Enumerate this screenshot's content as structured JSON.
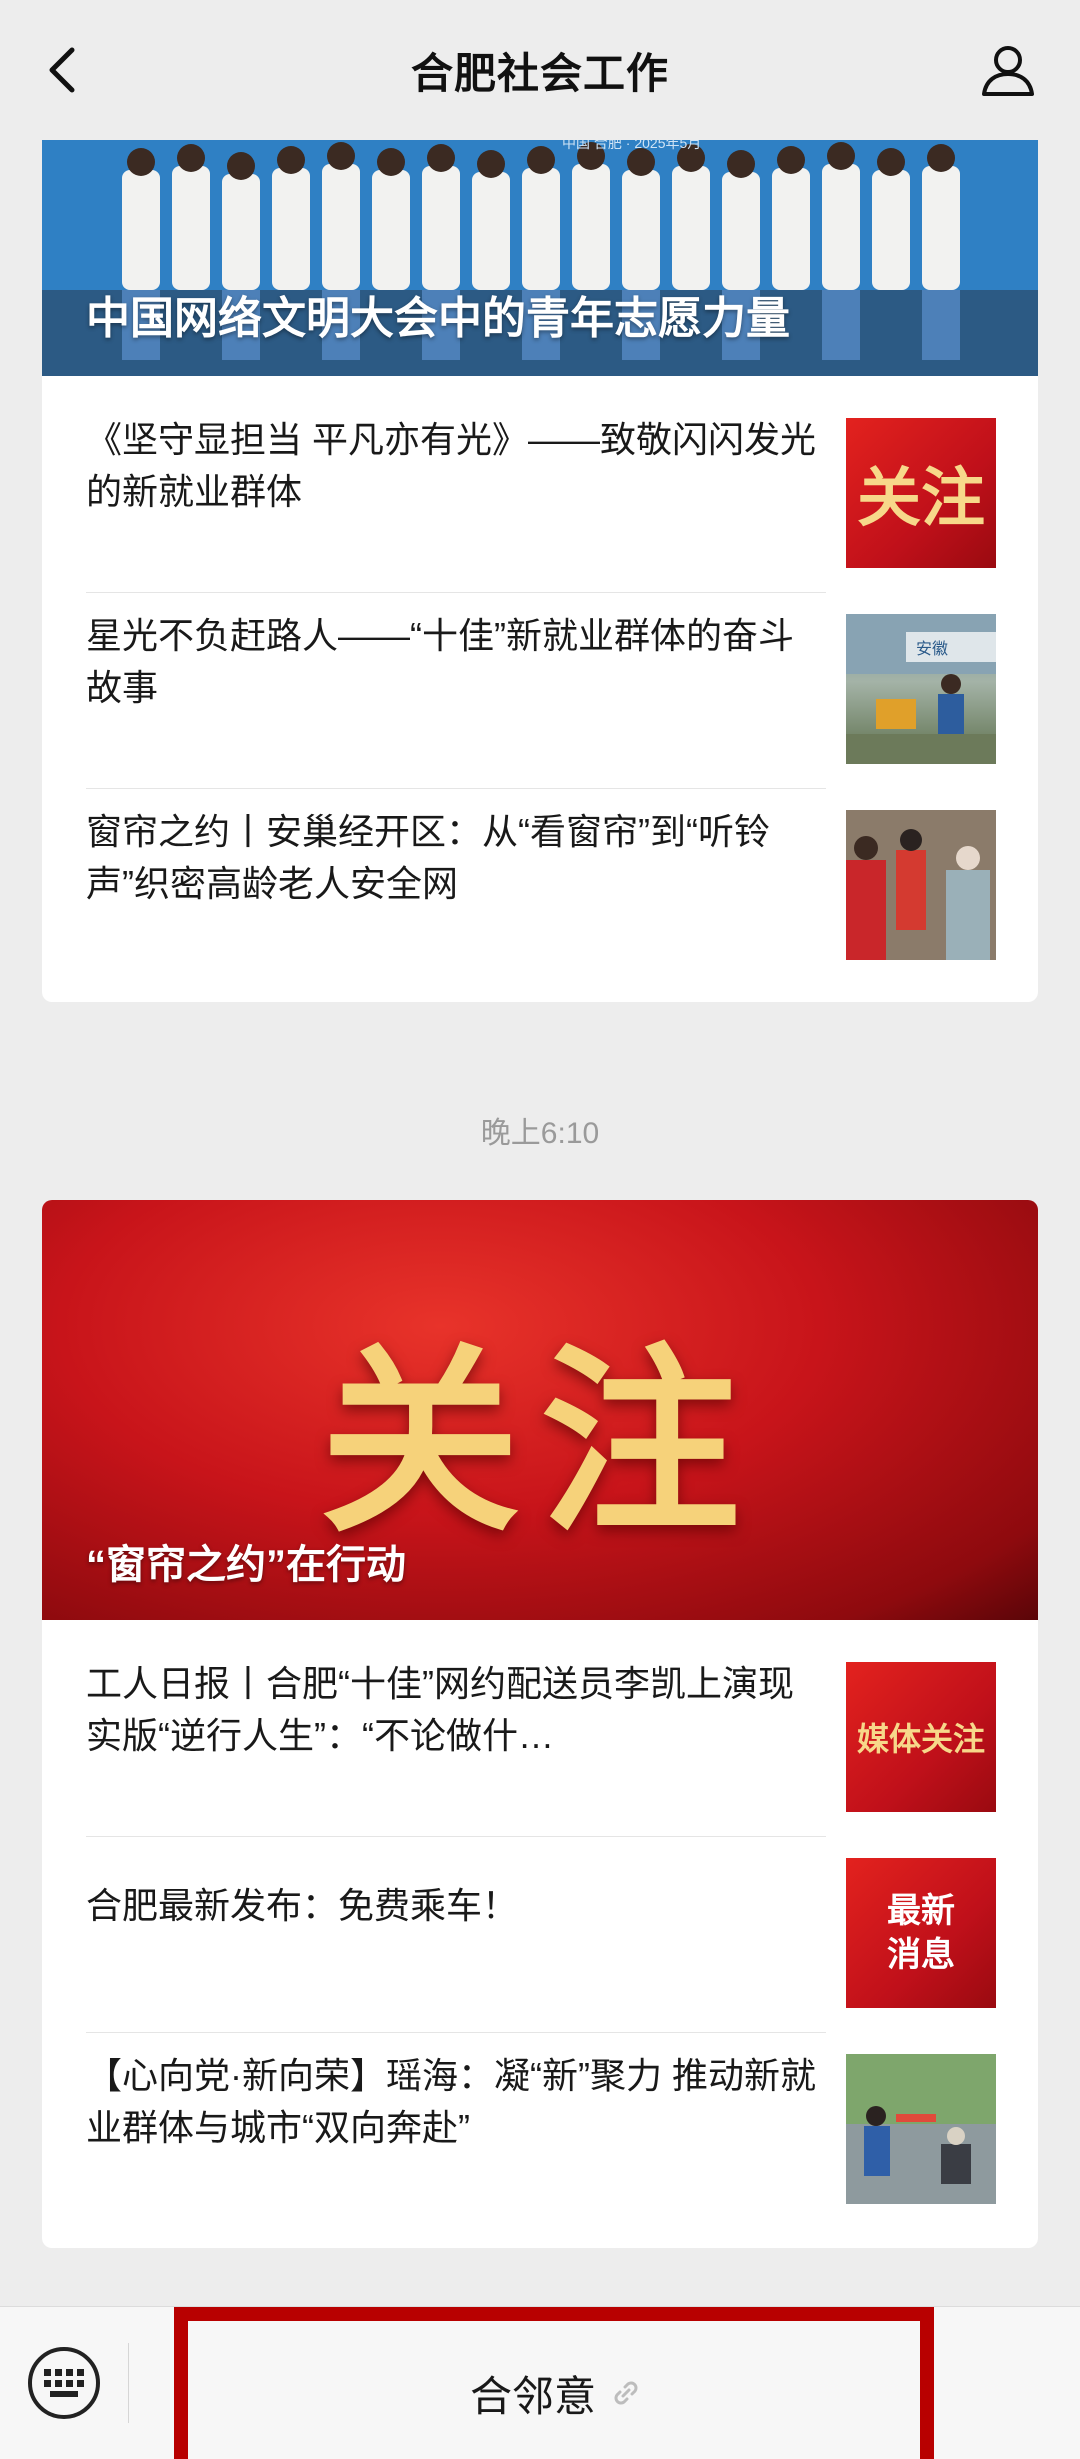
{
  "header": {
    "title": "合肥社会工作",
    "back_icon": "chevron-left-icon",
    "profile_icon": "user-icon"
  },
  "card1": {
    "hero_title": "中国网络文明大会中的青年志愿力量",
    "hero_backdrop_text": "中国 合肥 · 2025年5月",
    "items": [
      {
        "text": "《坚守显担当 平凡亦有光》——致敬闪闪发光的新就业群体",
        "thumb_text": "关注"
      },
      {
        "text": "星光不负赶路人——“十佳”新就业群体的奋斗故事",
        "thumb_text": "安徽"
      },
      {
        "text": "窗帘之约丨安巢经开区：从“看窗帘”到“听铃声”织密高龄老人安全网"
      }
    ]
  },
  "timestamp": "晚上6:10",
  "card2": {
    "hero_big_text": "关注",
    "hero_title": "“窗帘之约”在行动",
    "items": [
      {
        "text": "工人日报丨合肥“十佳”网约配送员李凯上演现实版“逆行人生”：“不论做什…",
        "thumb_text": "媒体关注"
      },
      {
        "text": "合肥最新发布：免费乘车！",
        "thumb_text": "最新消息"
      },
      {
        "text": "【心向党·新向荣】瑶海：凝“新”聚力 推动新就业群体与城市“双向奔赴”"
      }
    ]
  },
  "bottom_bar": {
    "keyboard_icon": "keyboard-icon",
    "menu_label": "合邻意",
    "link_icon": "link-icon"
  },
  "colors": {
    "accent_red": "#b80000",
    "background": "#ededed"
  }
}
